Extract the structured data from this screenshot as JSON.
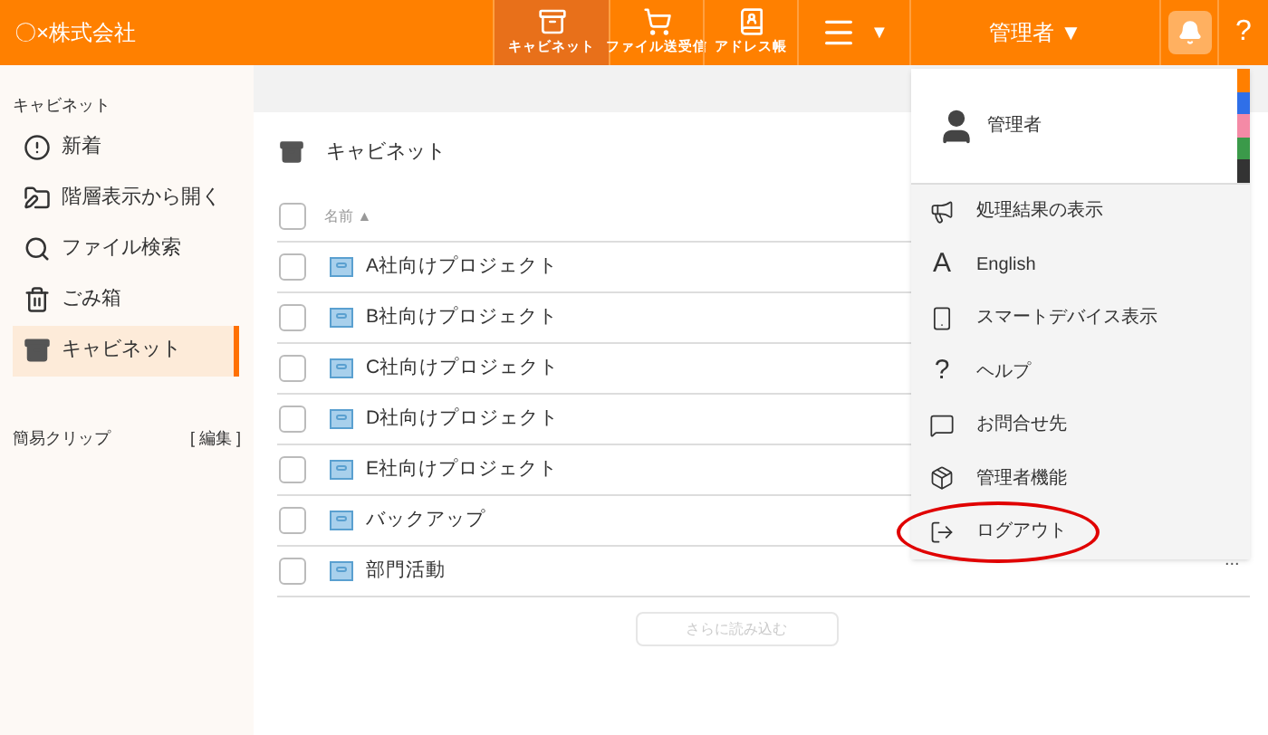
{
  "header": {
    "logo": "〇×株式会社",
    "nav": [
      {
        "label": "キャビネット",
        "selected": true
      },
      {
        "label": "ファイル送受信",
        "selected": false
      },
      {
        "label": "アドレス帳",
        "selected": false
      }
    ],
    "menu_caret": "▼",
    "user": "管理者 ▼",
    "help": "?"
  },
  "sidebar": {
    "section": "キャビネット",
    "items": [
      {
        "label": "新着",
        "selected": false
      },
      {
        "label": "階層表示から開く",
        "selected": false
      },
      {
        "label": "ファイル検索",
        "selected": false
      },
      {
        "label": "ごみ箱",
        "selected": false
      },
      {
        "label": "キャビネット",
        "selected": true
      }
    ],
    "clip_title": "簡易クリップ",
    "clip_edit": "[ 編集 ]"
  },
  "content": {
    "title": "キャビネット",
    "column": "名前 ▲",
    "all_checked": false,
    "rows": [
      {
        "name": "A社向けプロジェクト",
        "checked": false
      },
      {
        "name": "B社向けプロジェクト",
        "checked": false
      },
      {
        "name": "C社向けプロジェクト",
        "checked": false
      },
      {
        "name": "D社向けプロジェクト",
        "checked": false
      },
      {
        "name": "E社向けプロジェクト",
        "checked": false
      },
      {
        "name": "バックアップ",
        "checked": false
      },
      {
        "name": "部門活動",
        "checked": false
      }
    ],
    "load_more": "さらに読み込む",
    "more": "..."
  },
  "dropdown": {
    "user": "管理者",
    "theme_colors": [
      {
        "color": "#ff7f00"
      },
      {
        "color": "#2f6fe8"
      },
      {
        "color": "#f48aa6"
      },
      {
        "color": "#3b9a4a"
      },
      {
        "color": "#333333"
      }
    ],
    "items": [
      {
        "label": "処理結果の表示",
        "kind": "results"
      },
      {
        "label": "English",
        "kind": "glyph",
        "glyph": "A"
      },
      {
        "label": "スマートデバイス表示",
        "kind": "device"
      },
      {
        "label": "ヘルプ",
        "kind": "glyph",
        "glyph": "?"
      },
      {
        "label": "お問合せ先",
        "kind": "contact"
      },
      {
        "label": "管理者機能",
        "kind": "admin"
      },
      {
        "label": "ログアウト",
        "kind": "logout",
        "highlighted": true
      }
    ]
  }
}
